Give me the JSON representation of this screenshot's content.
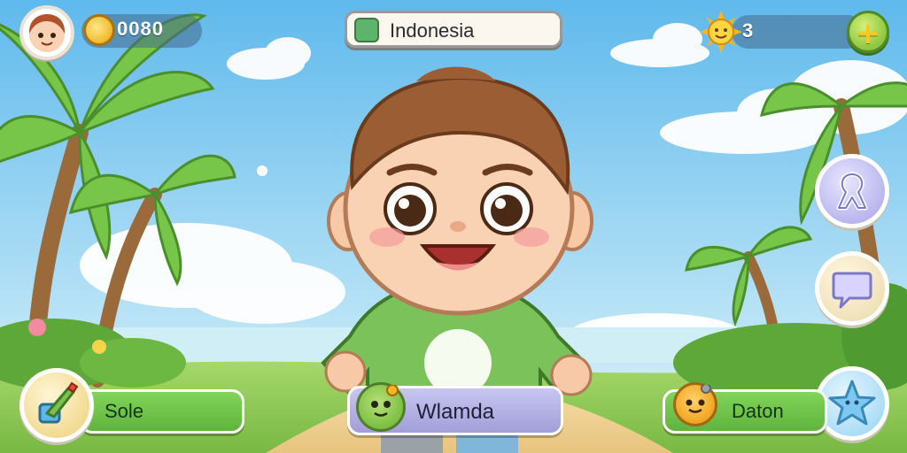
{
  "hud": {
    "coins": "0080",
    "region": "Indonesia",
    "suns": "3"
  },
  "buttons": {
    "left_pill": "Sole",
    "center_pill": "Wlamda",
    "right_pill": "Daton"
  },
  "icons": {
    "avatar": "player-avatar",
    "coin": "coin-icon",
    "region": "map-pin-icon",
    "sun": "sun-icon",
    "plus": "plus-icon",
    "ribbon": "ribbon-icon",
    "chat": "chat-bubble-icon",
    "star": "starfish-icon",
    "edit": "paintbrush-icon"
  },
  "colors": {
    "sky": "#7fc8ef",
    "grass": "#8fcf55",
    "pill_green": "#6cc043",
    "pill_purple": "#b3b0e6"
  }
}
